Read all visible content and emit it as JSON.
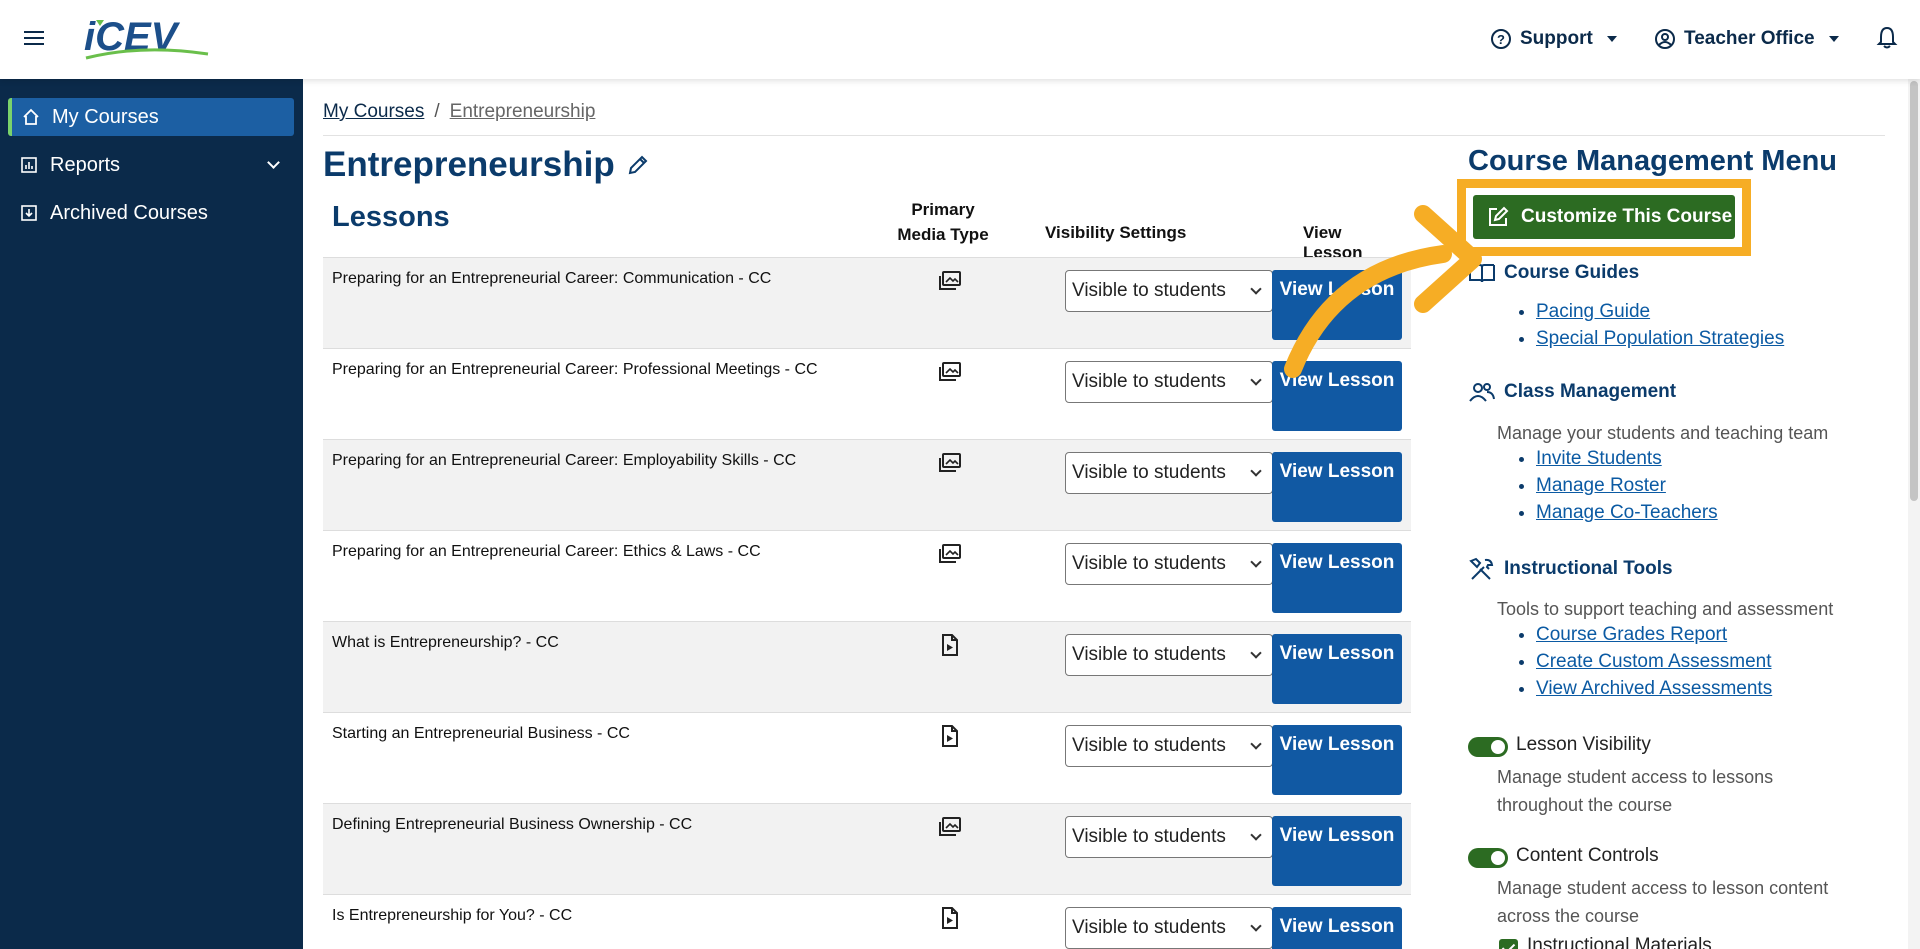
{
  "header": {
    "logo_text": "iCEV",
    "support_label": "Support",
    "account_label": "Teacher Office"
  },
  "sidebar": {
    "items": [
      {
        "label": "My Courses",
        "icon": "home-icon",
        "active": true
      },
      {
        "label": "Reports",
        "icon": "chart-icon",
        "expandable": true
      },
      {
        "label": "Archived Courses",
        "icon": "archive-icon"
      }
    ]
  },
  "breadcrumb": {
    "root": "My Courses",
    "separator": "/",
    "current": "Entrepreneurship"
  },
  "page": {
    "title": "Entrepreneurship"
  },
  "lessons": {
    "heading": "Lessons",
    "col_media": "Primary Media Type",
    "col_visibility": "Visibility Settings",
    "col_view": "View Lesson",
    "view_button_label": "View Lesson",
    "rows": [
      {
        "title": "Preparing for an Entrepreneurial Career: Communication - CC",
        "media": "slides-icon",
        "visibility": "Visible to students"
      },
      {
        "title": "Preparing for an Entrepreneurial Career: Professional Meetings - CC",
        "media": "slides-icon",
        "visibility": "Visible to students"
      },
      {
        "title": "Preparing for an Entrepreneurial Career: Employability Skills - CC",
        "media": "slides-icon",
        "visibility": "Visible to students"
      },
      {
        "title": "Preparing for an Entrepreneurial Career: Ethics & Laws - CC",
        "media": "slides-icon",
        "visibility": "Visible to students"
      },
      {
        "title": "What is Entrepreneurship? - CC",
        "media": "video-file-icon",
        "visibility": "Visible to students"
      },
      {
        "title": "Starting an Entrepreneurial Business - CC",
        "media": "video-file-icon",
        "visibility": "Visible to students"
      },
      {
        "title": "Defining Entrepreneurial Business Ownership - CC",
        "media": "slides-icon",
        "visibility": "Visible to students"
      },
      {
        "title": "Is Entrepreneurship for You? - CC",
        "media": "video-file-icon",
        "visibility": "Visible to students"
      }
    ]
  },
  "course_menu": {
    "title": "Course Management Menu",
    "customize_label": "Customize This Course",
    "guides": {
      "heading": "Course Guides",
      "links": [
        "Pacing Guide",
        "Special Population Strategies"
      ]
    },
    "class_mgmt": {
      "heading": "Class Management",
      "description": "Manage your students and teaching team",
      "links": [
        "Invite Students",
        "Manage Roster",
        "Manage Co-Teachers"
      ]
    },
    "tools": {
      "heading": "Instructional Tools",
      "description": "Tools to support teaching and assessment",
      "links": [
        "Course Grades Report",
        "Create Custom Assessment",
        "View Archived Assessments"
      ]
    },
    "lesson_visibility": {
      "label": "Lesson Visibility",
      "description": "Manage student access to lessons throughout the course",
      "on": true
    },
    "content_controls": {
      "label": "Content Controls",
      "description": "Manage student access to lesson content across the course",
      "on": true
    },
    "instructional_materials": {
      "label": "Instructional Materials",
      "checked": true
    }
  },
  "colors": {
    "navy": "#0b2a4a",
    "brand_blue": "#1159a3",
    "brand_green": "#2c6b22",
    "highlight_orange": "#f6ad25"
  }
}
